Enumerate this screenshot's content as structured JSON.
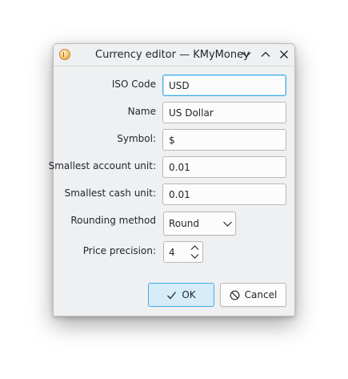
{
  "window": {
    "title": "Currency editor — KMyMoney",
    "controls": {
      "minimize_icon": "chevron-down-icon",
      "maximize_icon": "chevron-up-icon",
      "close_icon": "close-icon"
    }
  },
  "form": {
    "iso_code": {
      "label": "ISO Code",
      "value": "USD"
    },
    "name": {
      "label": "Name",
      "value": "US Dollar"
    },
    "symbol": {
      "label": "Symbol:",
      "value": "$"
    },
    "smallest_account_unit": {
      "label": "Smallest account unit:",
      "value": "0.01"
    },
    "smallest_cash_unit": {
      "label": "Smallest cash unit:",
      "value": "0.01"
    },
    "rounding_method": {
      "label": "Rounding method",
      "selected": "Round"
    },
    "price_precision": {
      "label": "Price precision:",
      "value": "4"
    }
  },
  "buttons": {
    "ok": "OK",
    "cancel": "Cancel"
  },
  "colors": {
    "focus_accent": "#3daee9",
    "dialog_bg": "#eff0f1"
  }
}
